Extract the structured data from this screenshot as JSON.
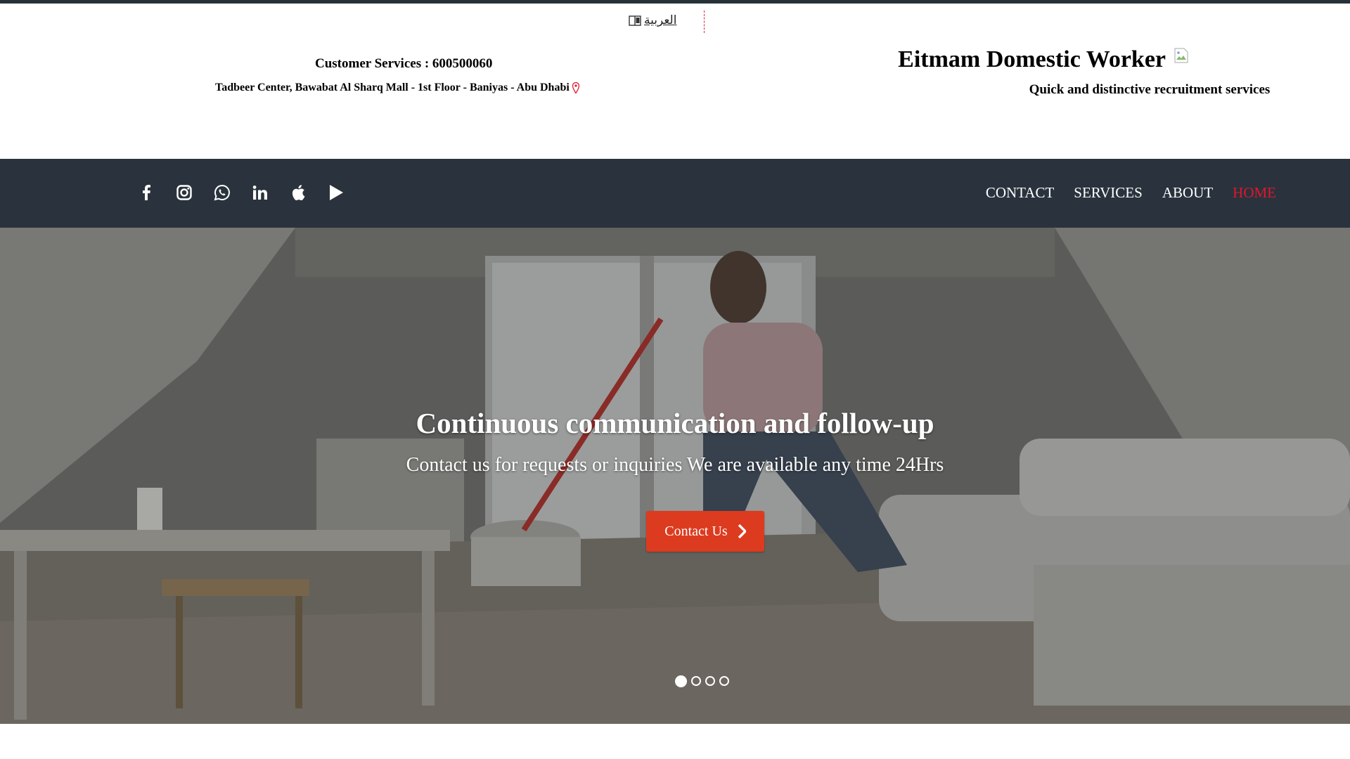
{
  "header": {
    "language_link": "العربية",
    "customer_services": "Customer Services : 600500060",
    "address": "Tadbeer Center, Bawabat Al Sharq Mall - 1st Floor - Baniyas - Abu Dhabi",
    "brand_title": "Eitmam Domestic Worker",
    "tagline": "Quick and distinctive recruitment services"
  },
  "social": [
    "facebook-icon",
    "instagram-icon",
    "whatsapp-icon",
    "linkedin-icon",
    "apple-icon",
    "play-icon"
  ],
  "nav": {
    "items": [
      {
        "label": "CONTACT"
      },
      {
        "label": "SERVICES"
      },
      {
        "label": "ABOUT"
      },
      {
        "label": "HOME",
        "active": true
      }
    ]
  },
  "hero": {
    "title": "Continuous communication and follow-up",
    "subtitle": "Contact us for requests or inquiries We are available any time 24Hrs",
    "button_label": "Contact Us",
    "slides": 4,
    "active_slide": 1
  },
  "colors": {
    "accent": "#e0162b",
    "button": "#dd3b1f",
    "navbar": "#2a333d"
  }
}
